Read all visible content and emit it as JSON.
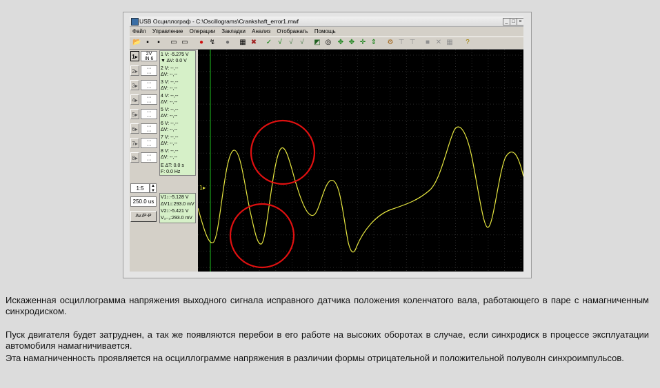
{
  "window": {
    "title": "USB Осциллограф - C:\\Oscillograms\\Crankshaft_error1.mwf",
    "controls": [
      "_",
      "□",
      "×"
    ]
  },
  "menu": [
    "Файл",
    "Управление",
    "Операции",
    "Закладки",
    "Анализ",
    "Отображать",
    "Помощь"
  ],
  "toolbar_icons": [
    {
      "name": "open-icon",
      "glyph": "📂"
    },
    {
      "name": "save-icon",
      "glyph": "▪"
    },
    {
      "name": "save-as-icon",
      "glyph": "▪"
    },
    {
      "name": "print-icon",
      "glyph": "▭"
    },
    {
      "name": "print-preview-icon",
      "glyph": "▭"
    },
    {
      "name": "stop-icon",
      "glyph": "●",
      "color": "#d01010"
    },
    {
      "name": "run-icon",
      "glyph": "↯"
    },
    {
      "name": "record-icon",
      "glyph": "●",
      "color": "#707070"
    },
    {
      "name": "export-icon",
      "glyph": "▦"
    },
    {
      "name": "tool-icon",
      "glyph": "✖",
      "color": "#a02020"
    },
    {
      "name": "check-icon",
      "glyph": "✓",
      "color": "#108010"
    },
    {
      "name": "marker-a-icon",
      "glyph": "√",
      "color": "#108010"
    },
    {
      "name": "marker-b-icon",
      "glyph": "√",
      "color": "#508050"
    },
    {
      "name": "marker-c-icon",
      "glyph": "√",
      "color": "#508050"
    },
    {
      "name": "color-icon",
      "glyph": "◩",
      "color": "#206020"
    },
    {
      "name": "zoom-icon",
      "glyph": "◎"
    },
    {
      "name": "cursor-a-icon",
      "glyph": "✥",
      "color": "#108010"
    },
    {
      "name": "cursor-b-icon",
      "glyph": "✥",
      "color": "#108010"
    },
    {
      "name": "cursor-c-icon",
      "glyph": "✛",
      "color": "#108010"
    },
    {
      "name": "cursor-d-icon",
      "glyph": "⇕",
      "color": "#108010"
    },
    {
      "name": "settings-icon",
      "glyph": "⚙",
      "color": "#a06010"
    },
    {
      "name": "filter-icon",
      "glyph": "⊤",
      "color": "#909090"
    },
    {
      "name": "filter2-icon",
      "glyph": "⊤",
      "color": "#909090"
    },
    {
      "name": "square-icon",
      "glyph": "■",
      "color": "#909090"
    },
    {
      "name": "cancel-icon",
      "glyph": "✕",
      "color": "#909090"
    },
    {
      "name": "grid-icon",
      "glyph": "▦",
      "color": "#909090"
    },
    {
      "name": "help-icon",
      "glyph": "?",
      "color": "#a08000"
    }
  ],
  "channels": [
    {
      "num": "1▸",
      "line1": "2V",
      "line2": "IN 6"
    },
    {
      "num": "2▸",
      "line1": "···",
      "line2": "···"
    },
    {
      "num": "3▸",
      "line1": "···",
      "line2": "···"
    },
    {
      "num": "4▸",
      "line1": "···",
      "line2": "···"
    },
    {
      "num": "5▸",
      "line1": "···",
      "line2": "···"
    },
    {
      "num": "6▸",
      "line1": "···",
      "line2": "···"
    },
    {
      "num": "7▸",
      "line1": "···",
      "line2": "···"
    },
    {
      "num": "8▸",
      "line1": "···",
      "line2": "···"
    }
  ],
  "values": [
    {
      "a": "1  V:   -5.275 V",
      "b": "▼ ΔV:     0.0 V"
    },
    {
      "a": "2  V:      --,--",
      "b": "   ΔV:      --,--"
    },
    {
      "a": "3  V:      --,--",
      "b": "   ΔV:      --,--"
    },
    {
      "a": "4  V:      --,--",
      "b": "   ΔV:      --,--"
    },
    {
      "a": "5  V:      --,--",
      "b": "   ΔV:      --,--"
    },
    {
      "a": "6  V:      --,--",
      "b": "   ΔV:      --,--"
    },
    {
      "a": "7  V:      --,--",
      "b": "   ΔV:      --,--"
    },
    {
      "a": "8  V:      --,--",
      "b": "   ΔV:      --,--"
    }
  ],
  "time_info": {
    "a": "E  ΔT:    0.0 s",
    "b": "    F:    0.0 Hz"
  },
  "scale": "1:5",
  "timebase": "250.0 us",
  "mode_button": "Av./P-P",
  "measurements": [
    "V1↕:-5.128 V",
    "ΔV1↕:293.0 mV",
    "V2↕:-5.421 V",
    "V₃₋₃:293.0 mV"
  ],
  "scope": {
    "channel_marker": "1▸",
    "trace_color": "#e8e840",
    "grid_color": "#2a2a2a",
    "highlight_color": "#e01010"
  },
  "caption": {
    "p1": "Искаженная осциллограмма напряжения выходного сигнала исправного датчика положения коленчатого вала, работающего в паре с намагниченным синхродиском.",
    "p2": "Пуск двигателя будет затруднен, а так же появляются перебои в его работе на высоких оборотах в случае, если синхродиск в процессе эксплуатации автомобиля намагничивается.",
    "p3": "Эта намагниченность проявляется на осциллограмме напряжения в различии формы отрицательной и положительной полуволн синхроимпульсов."
  }
}
